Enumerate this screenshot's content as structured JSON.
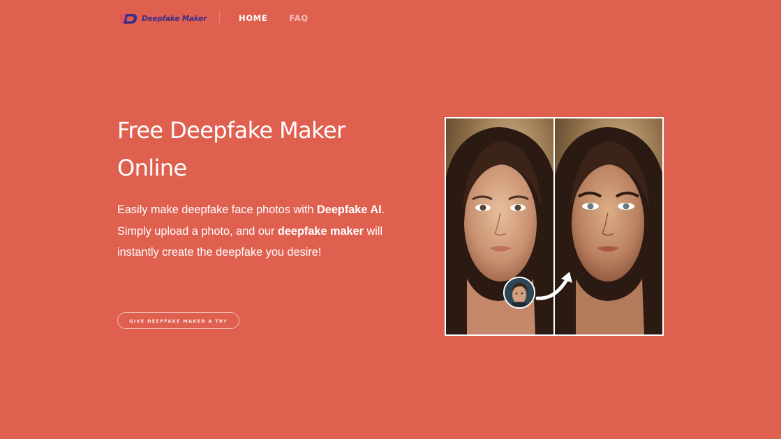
{
  "header": {
    "logo_text": "Deepfake Maker",
    "logo_icon": "deepfake-logo-icon",
    "nav": [
      {
        "label": "HOME",
        "active": true
      },
      {
        "label": "FAQ",
        "active": false
      }
    ]
  },
  "hero": {
    "title_line1": "Free Deepfake Maker",
    "title_line2": "Online",
    "desc_part1": "Easily make deepfake face photos with ",
    "desc_bold1": "Deepfake AI",
    "desc_part2": ". Simply upload a photo, and our ",
    "desc_bold2": "deepfake maker",
    "desc_part3": " will instantly create the deepfake you desire!",
    "cta_label": "GIVE DEEPFAKE MAKER A TRY"
  },
  "showcase": {
    "icons": [
      "source-portrait",
      "face-avatar",
      "curved-arrow-icon",
      "result-portrait"
    ]
  },
  "colors": {
    "background": "#e06050",
    "logo": "#3a2e86",
    "text": "#ffffff"
  }
}
